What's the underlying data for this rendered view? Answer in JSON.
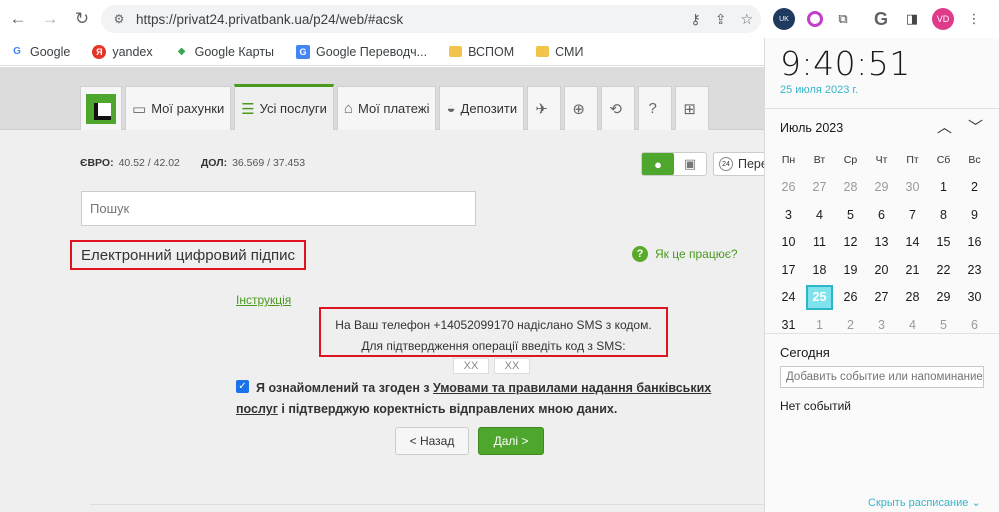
{
  "browser": {
    "url": "https://privat24.privatbank.ua/p24/web/#acsk",
    "bookmarks": [
      {
        "label": "Google",
        "icon": "G"
      },
      {
        "label": "yandex",
        "icon": "Я"
      },
      {
        "label": "Google Карты",
        "icon": "◆"
      },
      {
        "label": "Google Переводч...",
        "icon": "G"
      },
      {
        "label": "ВСПОМ",
        "icon": ""
      },
      {
        "label": "СМИ",
        "icon": ""
      }
    ]
  },
  "bank": {
    "tabs": {
      "accounts": "Мої рахунки",
      "all_services": "Усі послуги",
      "payments": "Мої платежі",
      "deposits": "Депозити"
    },
    "rates": {
      "eur_label": "ЄВРО:",
      "eur_value": "40.52 / 42.02",
      "usd_label": "ДОЛ:",
      "usd_value": "36.569 / 37.453"
    },
    "p24_label": "Пере",
    "search_placeholder": "Пошук",
    "title": "Електронний цифровий підпис",
    "help": "Як це працює?",
    "instruction": "Інструкція",
    "sms_line1": "На Ваш телефон +14052099170 надіслано SMS з кодом.",
    "sms_line2": "Для підтвердження операції введіть код з SMS:",
    "code_boxes": [
      "XX",
      "XX"
    ],
    "agree_prefix": "Я ознайомлений та згоден з",
    "agree_link": "Умовами та правилами надання банківських послуг",
    "agree_suffix": "і підтверджую коректність відправлених мною даних.",
    "back_button": "< Назад",
    "next_button": "Далі >"
  },
  "calendar": {
    "time": "9:40:51",
    "date_text": "25 июля 2023 г.",
    "month_label": "Июль 2023",
    "weekdays": [
      "Пн",
      "Вт",
      "Ср",
      "Чт",
      "Пт",
      "Сб",
      "Вс"
    ],
    "weeks": [
      [
        "26",
        "27",
        "28",
        "29",
        "30",
        "1",
        "2"
      ],
      [
        "3",
        "4",
        "5",
        "6",
        "7",
        "8",
        "9"
      ],
      [
        "10",
        "11",
        "12",
        "13",
        "14",
        "15",
        "16"
      ],
      [
        "17",
        "18",
        "19",
        "20",
        "21",
        "22",
        "23"
      ],
      [
        "24",
        "25",
        "26",
        "27",
        "28",
        "29",
        "30"
      ],
      [
        "31",
        "1",
        "2",
        "3",
        "4",
        "5",
        "6"
      ]
    ],
    "today_label": "Сегодня",
    "event_placeholder": "Добавить событие или напоминание",
    "no_events": "Нет событий",
    "hide_schedule": "Скрыть расписание ⌄"
  },
  "colors": {
    "brand_green": "#4ea72c",
    "highlight_red": "#e0141e",
    "today_accent": "#7fe3ee"
  }
}
